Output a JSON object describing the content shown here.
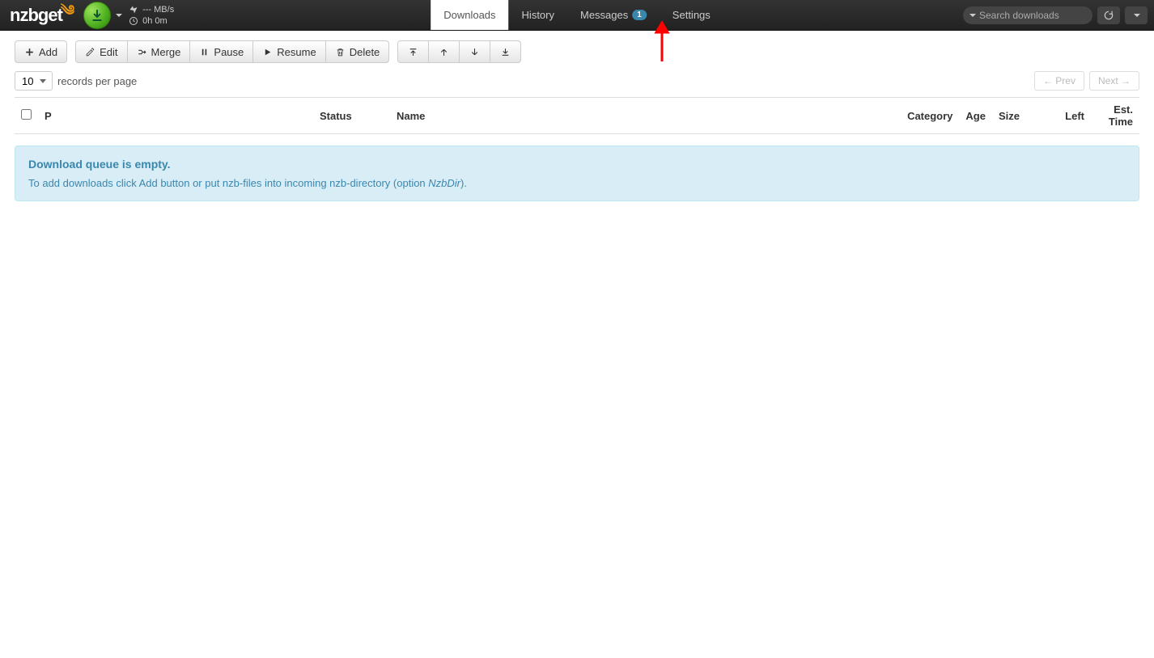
{
  "brand": {
    "part1": "nzb",
    "part2": "get"
  },
  "status": {
    "speed": "--- MB/s",
    "time": "0h 0m"
  },
  "nav": {
    "downloads": "Downloads",
    "history": "History",
    "messages": "Messages",
    "messages_badge": "1",
    "settings": "Settings"
  },
  "search": {
    "placeholder": "Search downloads"
  },
  "toolbar": {
    "add": "Add",
    "edit": "Edit",
    "merge": "Merge",
    "pause": "Pause",
    "resume": "Resume",
    "delete": "Delete"
  },
  "records": {
    "value": "10",
    "label": "records per page"
  },
  "pagination": {
    "prev": "← Prev",
    "next": "Next →"
  },
  "columns": {
    "p": "P",
    "status": "Status",
    "name": "Name",
    "category": "Category",
    "age": "Age",
    "size": "Size",
    "left": "Left",
    "est_time": "Est. Time"
  },
  "empty": {
    "title": "Download queue is empty.",
    "text_pre": "To add downloads click Add button or put nzb-files into incoming nzb-directory (option ",
    "text_em": "NzbDir",
    "text_post": ")."
  }
}
